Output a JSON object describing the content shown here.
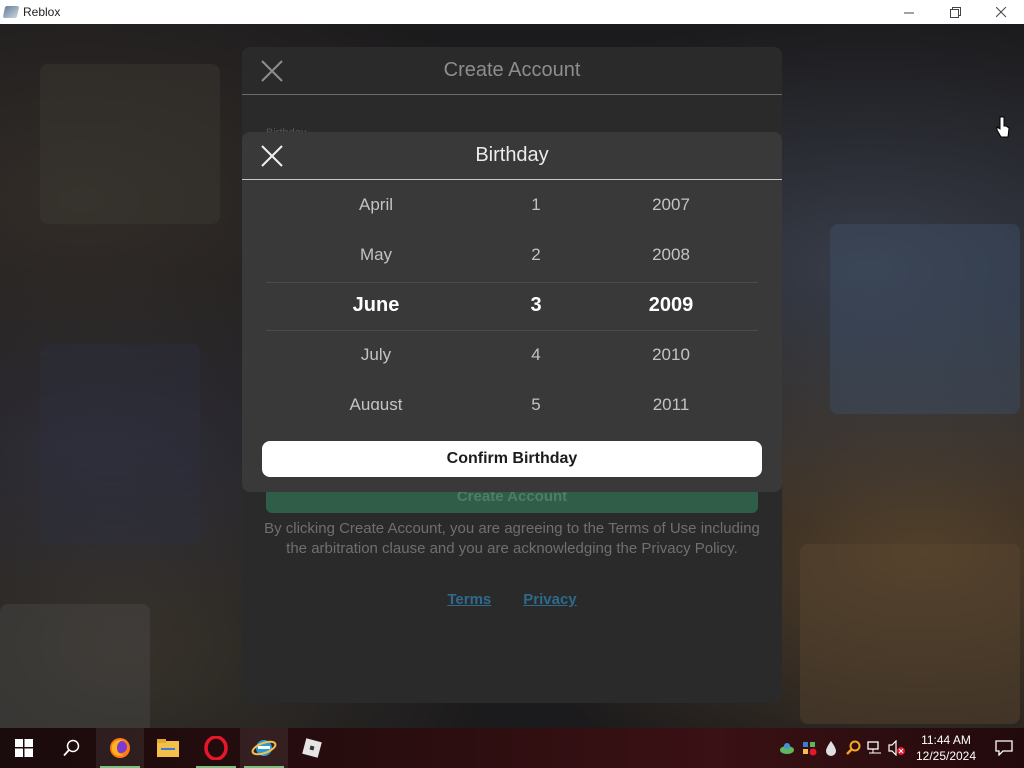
{
  "window": {
    "title": "Reblox",
    "controls": [
      "minimize-icon",
      "restore-icon",
      "close-icon"
    ]
  },
  "create_account": {
    "title": "Create Account",
    "birthday_label": "Birthday",
    "submit_label": "Create Account",
    "legal_text": "By clicking Create Account, you are agreeing to the Terms of Use including the arbitration clause and you are acknowledging the Privacy Policy.",
    "terms_link": "Terms",
    "privacy_link": "Privacy"
  },
  "birthday_modal": {
    "title": "Birthday",
    "rows": [
      {
        "month": "April",
        "day": "1",
        "year": "2007"
      },
      {
        "month": "May",
        "day": "2",
        "year": "2008"
      },
      {
        "month": "June",
        "day": "3",
        "year": "2009"
      },
      {
        "month": "July",
        "day": "4",
        "year": "2010"
      },
      {
        "month": "August",
        "day": "5",
        "year": "2011"
      }
    ],
    "selected_index": 2,
    "confirm_label": "Confirm Birthday"
  },
  "taskbar": {
    "apps": [
      "windows-start-icon",
      "search-icon",
      "firefox-icon",
      "file-explorer-icon",
      "opera-icon",
      "ie-icon",
      "roblox-icon"
    ],
    "clock_time": "11:44 AM",
    "clock_date": "12/25/2024"
  },
  "colors": {
    "modal_bg": "#39393a",
    "panel_bg": "#2a2a2b",
    "confirm_bg": "#ffffff",
    "create_btn_bg": "#2f5d47",
    "link": "#2e6a8d"
  }
}
